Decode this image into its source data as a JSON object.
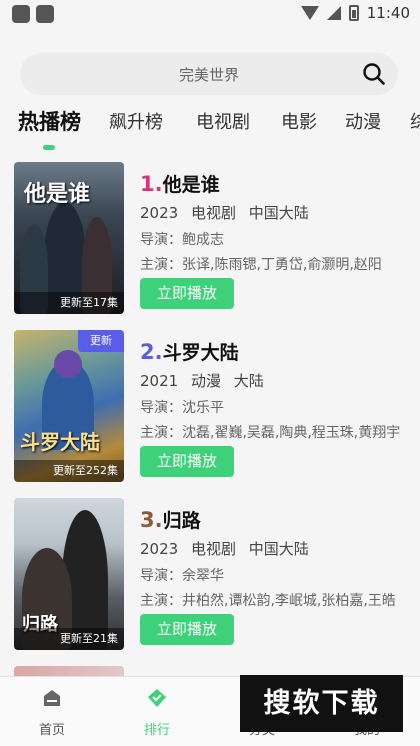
{
  "status_bar": {
    "time": "11:40"
  },
  "search": {
    "placeholder": "完美世界"
  },
  "tabs": [
    "热播榜",
    "飙升榜",
    "电视剧",
    "电影",
    "动漫",
    "综"
  ],
  "active_tab": "热播榜",
  "items": [
    {
      "rank": "1.",
      "title": "他是谁",
      "year": "2023",
      "type": "电视剧",
      "region": "中国大陆",
      "director": "导演：鲍成志",
      "cast": "主演：张译,陈雨锶,丁勇岱,俞灏明,赵阳",
      "play_label": "立即播放",
      "poster_caption": "更新至17集",
      "poster_art": "他是谁",
      "rank_color": "#d6337a"
    },
    {
      "rank": "2.",
      "title": "斗罗大陆",
      "year": "2021",
      "type": "动漫",
      "region": "大陆",
      "director": "导演：沈乐平",
      "cast": "主演：沈磊,翟巍,吴磊,陶典,程玉珠,黄翔宇",
      "play_label": "立即播放",
      "poster_caption": "更新至252集",
      "poster_badge": "更新",
      "poster_art": "斗罗大陆",
      "rank_color": "#5a5de8"
    },
    {
      "rank": "3.",
      "title": "归路",
      "year": "2023",
      "type": "电视剧",
      "region": "中国大陆",
      "director": "导演：余翠华",
      "cast": "主演：井柏然,谭松韵,李岷城,张柏嘉,王皓",
      "play_label": "立即播放",
      "poster_caption": "更新至21集",
      "poster_art": "归路",
      "rank_color": "#8a5a3c"
    }
  ],
  "bottom_nav": [
    {
      "label": "首页",
      "icon": "home-icon"
    },
    {
      "label": "排行",
      "icon": "ranking-icon"
    },
    {
      "label": "分类",
      "icon": "category-icon"
    },
    {
      "label": "我的",
      "icon": "profile-icon"
    }
  ],
  "watermark": "搜软下载",
  "colors": {
    "accent": "#3fd07a",
    "badge": "#5a5de8"
  }
}
